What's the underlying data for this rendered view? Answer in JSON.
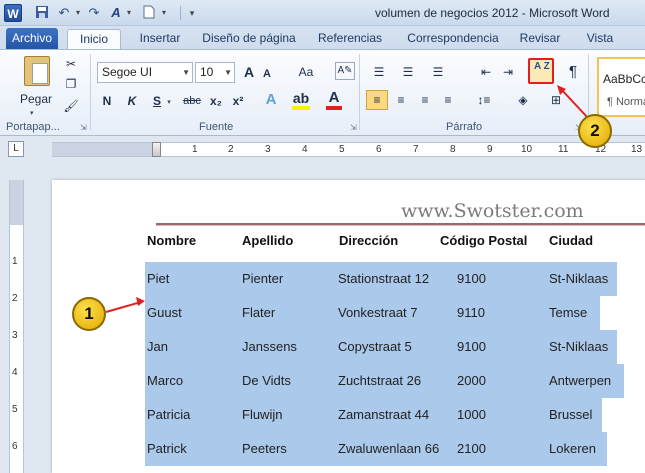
{
  "window": {
    "app_icon": "W",
    "title": "volumen de negocios 2012 - Microsoft Word"
  },
  "quick_access": {
    "icons": [
      "save-icon",
      "undo-icon",
      "redo-icon",
      "text-style-icon",
      "new-document-icon"
    ]
  },
  "tabs": [
    "Archivo",
    "Inicio",
    "Insertar",
    "Diseño de página",
    "Referencias",
    "Correspondencia",
    "Revisar",
    "Vista"
  ],
  "active_tab": "Inicio",
  "ribbon": {
    "clipboard": {
      "label": "Portapap...",
      "paste_label": "Pegar"
    },
    "font": {
      "label": "Fuente",
      "font_name": "Segoe UI",
      "font_size": "10",
      "bold": "N",
      "italic": "K",
      "underline": "S",
      "strike": "abc",
      "subscript": "x₂",
      "superscript": "x²",
      "grow": "A",
      "shrink": "A",
      "change_case": "Aa"
    },
    "paragraph": {
      "label": "Párrafo",
      "sort_label": "A Z",
      "pilcrow": "¶"
    },
    "styles": {
      "sample": "AaBbCc",
      "name": "¶ Normal"
    }
  },
  "ruler": {
    "numbers": [
      "1",
      "2",
      "3",
      "4",
      "5",
      "6",
      "7",
      "8",
      "9",
      "10",
      "11",
      "12",
      "13"
    ]
  },
  "vruler": {
    "numbers": [
      "1",
      "2",
      "3",
      "4",
      "5",
      "6",
      "7"
    ]
  },
  "document": {
    "watermark": "www.Swotster.com",
    "headers": [
      "Nombre",
      "Apellido",
      "Dirección",
      "Código Postal",
      "Ciudad"
    ],
    "rows": [
      [
        "Piet",
        "Pienter",
        "Stationstraat 12",
        "9100",
        "St-Niklaas"
      ],
      [
        "Guust",
        "Flater",
        "Vonkestraat 7",
        "9110",
        "Temse"
      ],
      [
        "Jan",
        "Janssens",
        "Copystraat 5",
        "9100",
        "St-Niklaas"
      ],
      [
        "Marco",
        "De Vidts",
        "Zuchtstraat 26",
        "2000",
        "Antwerpen"
      ],
      [
        "Patricia",
        "Fluwijn",
        "Zamanstraat 44",
        "1000",
        "Brussel"
      ],
      [
        "Patrick",
        "Peeters",
        "Zwaluwenlaan 66",
        "2100",
        "Lokeren"
      ]
    ]
  },
  "callouts": {
    "one": "1",
    "two": "2"
  },
  "colors": {
    "selection": "#abc9ea",
    "callout": "#f5c400",
    "arrow": "#e02020",
    "ribbon_tab": "#2456a6"
  }
}
